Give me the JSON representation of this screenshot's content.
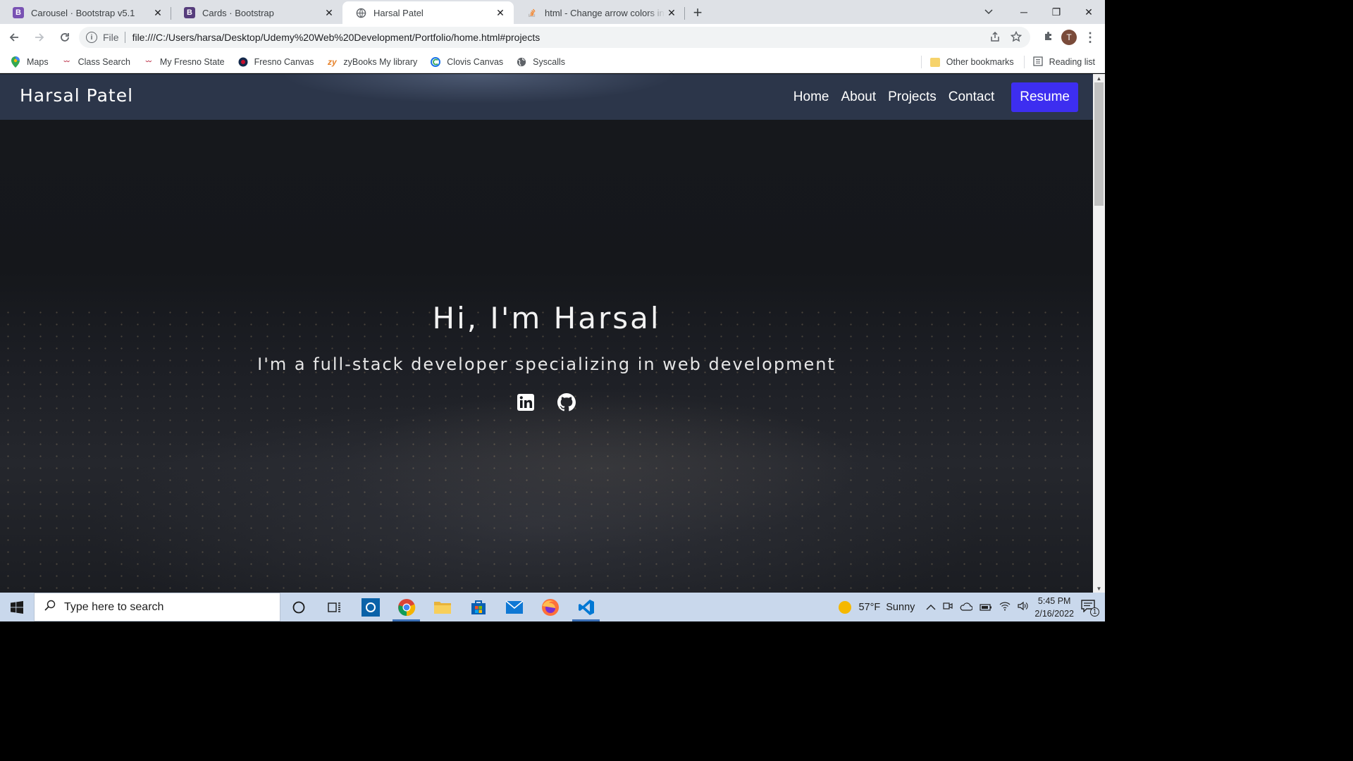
{
  "browser": {
    "tabs": [
      {
        "title": "Carousel · Bootstrap v5.1",
        "favicon": "bootstrap-icon",
        "favicon_letter": "B",
        "active": false
      },
      {
        "title": "Cards · Bootstrap",
        "favicon": "bootstrap-icon",
        "favicon_letter": "B",
        "active": false
      },
      {
        "title": "Harsal Patel",
        "favicon": "globe-icon",
        "active": true
      },
      {
        "title": "html - Change arrow colors in Bo",
        "favicon": "stackoverflow-icon",
        "active": false
      }
    ],
    "url_scheme": "File",
    "url": "file:///C:/Users/harsa/Desktop/Udemy%20Web%20Development/Portfolio/home.html#projects",
    "profile_initial": "T",
    "bookmarks": [
      {
        "label": "Maps",
        "icon": "maps-pin-icon"
      },
      {
        "label": "Class Search",
        "icon": "fresno-state-icon"
      },
      {
        "label": "My Fresno State",
        "icon": "fresno-state-icon"
      },
      {
        "label": "Fresno Canvas",
        "icon": "canvas-icon"
      },
      {
        "label": "zyBooks My library",
        "icon": "zybooks-icon",
        "icon_text": "zy"
      },
      {
        "label": "Clovis Canvas",
        "icon": "clovis-icon"
      },
      {
        "label": "Syscalls",
        "icon": "globe-icon"
      }
    ],
    "other_bookmarks": "Other bookmarks",
    "reading_list": "Reading list"
  },
  "site": {
    "brand": "Harsal Patel",
    "nav": [
      "Home",
      "About",
      "Projects",
      "Contact"
    ],
    "resume": "Resume",
    "accent_color": "#3d2ef0",
    "hero_title": "Hi, I'm Harsal",
    "hero_subtitle": "I'm a full-stack developer specializing in web development",
    "social": [
      "linkedin-icon",
      "github-icon"
    ]
  },
  "taskbar": {
    "search_placeholder": "Type here to search",
    "weather_temp": "57°F",
    "weather_text": "Sunny",
    "time": "5:45 PM",
    "date": "2/16/2022",
    "notification_count": "1"
  }
}
